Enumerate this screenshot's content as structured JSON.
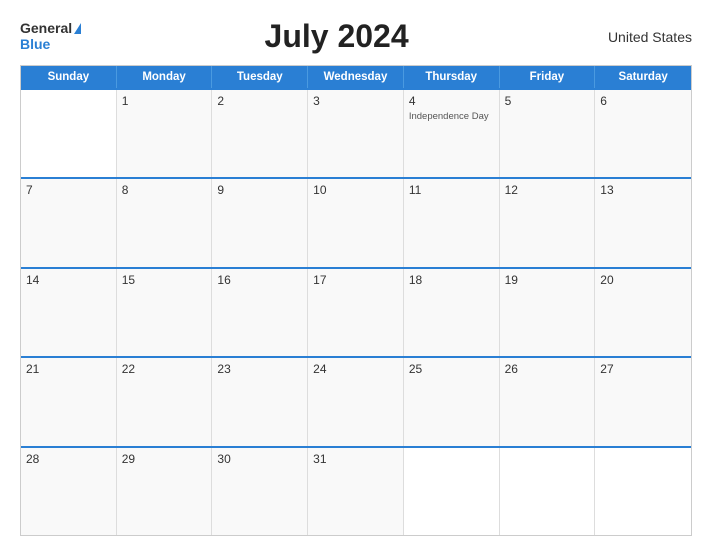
{
  "header": {
    "title": "July 2024",
    "country": "United States"
  },
  "logo": {
    "general": "General",
    "blue": "Blue"
  },
  "days": {
    "headers": [
      "Sunday",
      "Monday",
      "Tuesday",
      "Wednesday",
      "Thursday",
      "Friday",
      "Saturday"
    ]
  },
  "weeks": [
    [
      {
        "num": "",
        "empty": true
      },
      {
        "num": "1",
        "empty": false
      },
      {
        "num": "2",
        "empty": false
      },
      {
        "num": "3",
        "empty": false
      },
      {
        "num": "4",
        "empty": false,
        "event": "Independence Day"
      },
      {
        "num": "5",
        "empty": false
      },
      {
        "num": "6",
        "empty": false
      }
    ],
    [
      {
        "num": "7",
        "empty": false
      },
      {
        "num": "8",
        "empty": false
      },
      {
        "num": "9",
        "empty": false
      },
      {
        "num": "10",
        "empty": false
      },
      {
        "num": "11",
        "empty": false
      },
      {
        "num": "12",
        "empty": false
      },
      {
        "num": "13",
        "empty": false
      }
    ],
    [
      {
        "num": "14",
        "empty": false
      },
      {
        "num": "15",
        "empty": false
      },
      {
        "num": "16",
        "empty": false
      },
      {
        "num": "17",
        "empty": false
      },
      {
        "num": "18",
        "empty": false
      },
      {
        "num": "19",
        "empty": false
      },
      {
        "num": "20",
        "empty": false
      }
    ],
    [
      {
        "num": "21",
        "empty": false
      },
      {
        "num": "22",
        "empty": false
      },
      {
        "num": "23",
        "empty": false
      },
      {
        "num": "24",
        "empty": false
      },
      {
        "num": "25",
        "empty": false
      },
      {
        "num": "26",
        "empty": false
      },
      {
        "num": "27",
        "empty": false
      }
    ],
    [
      {
        "num": "28",
        "empty": false
      },
      {
        "num": "29",
        "empty": false
      },
      {
        "num": "30",
        "empty": false
      },
      {
        "num": "31",
        "empty": false
      },
      {
        "num": "",
        "empty": true
      },
      {
        "num": "",
        "empty": true
      },
      {
        "num": "",
        "empty": true
      }
    ]
  ],
  "colors": {
    "accent": "#2a7fd4"
  }
}
